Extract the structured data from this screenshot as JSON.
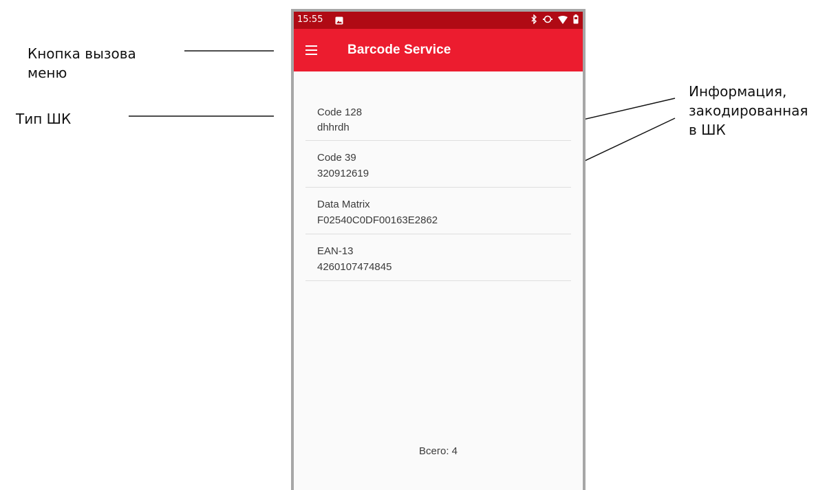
{
  "annotations": {
    "menu_button": "Кнопка вызова меню",
    "barcode_type": "Тип ШК",
    "encoded_info": "Информация, закодированная в ШК"
  },
  "status_bar": {
    "time": "15:55",
    "icons": [
      "image-icon",
      "bluetooth-icon",
      "sync-icon",
      "wifi-icon",
      "battery-icon"
    ],
    "color": "#b00a14"
  },
  "app_bar": {
    "title": "Barcode Service",
    "menu_icon": "hamburger-menu-icon",
    "color": "#ec1c2f"
  },
  "barcodes": [
    {
      "type": "Code 128",
      "value": "dhhrdh"
    },
    {
      "type": "Code 39",
      "value": "320912619"
    },
    {
      "type": "Data Matrix",
      "value": "F02540C0DF00163E2862"
    },
    {
      "type": "EAN-13",
      "value": "4260107474845"
    }
  ],
  "footer": {
    "total_label": "Всего: 4"
  }
}
